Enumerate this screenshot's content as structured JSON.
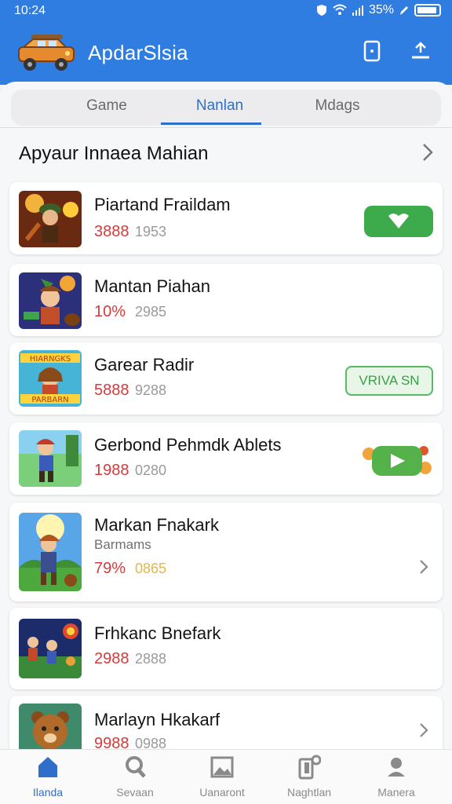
{
  "status_bar": {
    "time": "10:24",
    "battery": "35%"
  },
  "header": {
    "title": "ApdarSlsia"
  },
  "tabs": [
    {
      "label": "Game",
      "active": false
    },
    {
      "label": "Nanlan",
      "active": true
    },
    {
      "label": "Mdags",
      "active": false
    }
  ],
  "section": {
    "title": "Apyaur Innaea Mahian"
  },
  "items": [
    {
      "name": "Piartand Fraildam",
      "pct": "3888",
      "count": "1953",
      "pct_color": "#d63b3b",
      "action": "download"
    },
    {
      "name": "Mantan Piahan",
      "pct": "10%",
      "count": "2985",
      "pct_color": "#d63b3b",
      "action": "none"
    },
    {
      "name": "Garear Radir",
      "pct": "5888",
      "count": "9288",
      "pct_color": "#d63b3b",
      "action": "text-button",
      "action_label": "VRIVA SN"
    },
    {
      "name": "Gerbond Pehmdk Ablets",
      "pct": "1988",
      "count": "0280",
      "pct_color": "#d63b3b",
      "action": "play"
    },
    {
      "name": "Markan Fnakark",
      "sub": "Barmams",
      "pct": "79%",
      "count": "0865",
      "pct_color": "#d63b3b",
      "count_color": "#e0b84a",
      "action": "chevron"
    },
    {
      "name": "Frhkanc Bnefark",
      "pct": "2988",
      "count": "2888",
      "pct_color": "#d63b3b",
      "action": "none"
    },
    {
      "name": "Marlayn Hkakarf",
      "pct": "9988",
      "count": "0988",
      "pct_color": "#d63b3b",
      "action": "chevron"
    }
  ],
  "thumbs": [
    "",
    "",
    "HIARNGKS / PARBARN",
    "",
    "",
    "",
    ""
  ],
  "bottom_nav": [
    {
      "label": "Ilanda",
      "icon": "home-icon",
      "active": true
    },
    {
      "label": "Sevaan",
      "icon": "search-person-icon",
      "active": false
    },
    {
      "label": "Uanaront",
      "icon": "image-icon",
      "active": false
    },
    {
      "label": "Naghtlan",
      "icon": "phone-apps-icon",
      "active": false
    },
    {
      "label": "Manera",
      "icon": "profile-icon",
      "active": false
    }
  ],
  "colors": {
    "accent": "#2f7de0",
    "tab_active": "#2f6fc9",
    "green": "#3daa4b"
  }
}
